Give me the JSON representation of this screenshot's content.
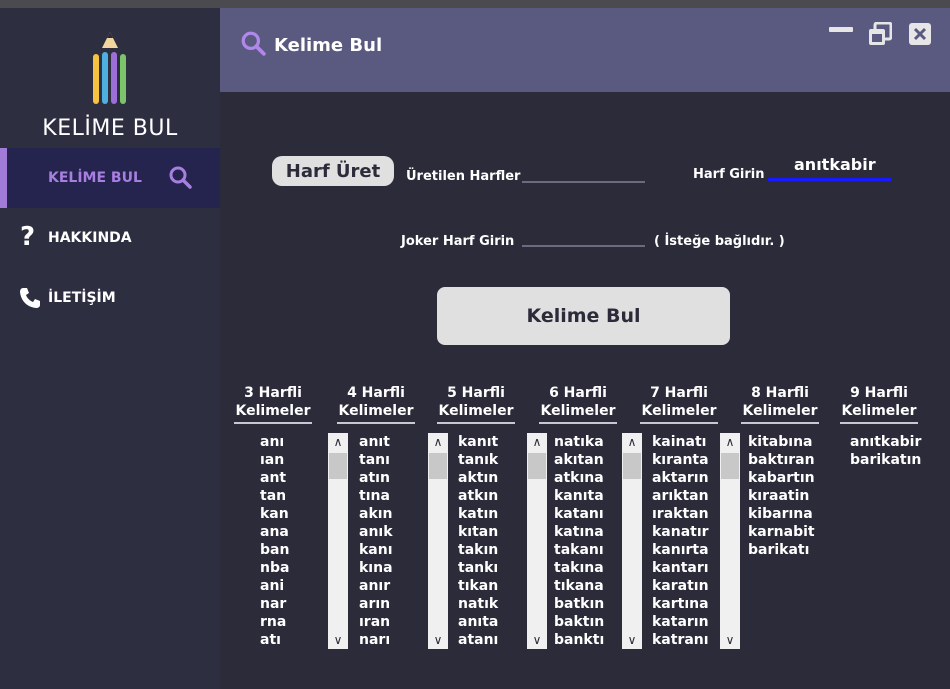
{
  "brand": {
    "name": "KELİME BUL"
  },
  "sidebar": {
    "items": [
      {
        "label": "KELİME BUL",
        "icon": "search-icon",
        "active": true
      },
      {
        "label": "HAKKINDA",
        "icon": "question-icon",
        "active": false
      },
      {
        "label": "İLETİŞİM",
        "icon": "phone-icon",
        "active": false
      }
    ]
  },
  "header": {
    "title": "Kelime Bul"
  },
  "form": {
    "generate_button": "Harf Üret",
    "generated_label": "Üretilen Harfler",
    "generated_value": "",
    "letters_label": "Harf Girin",
    "letters_value": "anıtkabir",
    "joker_label": "Joker Harf Girin",
    "joker_value": "",
    "joker_hint": "( İsteğe bağlıdır. )",
    "find_button": "Kelime Bul"
  },
  "columns": [
    {
      "line1": "3 Harfli",
      "line2": "Kelimeler",
      "words": [
        "anı",
        "ıan",
        "ant",
        "tan",
        "kan",
        "ana",
        "ban",
        "nba",
        "ani",
        "nar",
        "rna",
        "atı"
      ],
      "scroll": false
    },
    {
      "line1": "4 Harfli",
      "line2": "Kelimeler",
      "words": [
        "anıt",
        "tanı",
        "atın",
        "tına",
        "akın",
        "anık",
        "kanı",
        "kına",
        "anır",
        "arın",
        "ıran",
        "narı"
      ],
      "scroll": true
    },
    {
      "line1": "5 Harfli",
      "line2": "Kelimeler",
      "words": [
        "kanıt",
        "tanık",
        "aktın",
        "atkın",
        "katın",
        "kıtan",
        "takın",
        "tankı",
        "tıkan",
        "natık",
        "anıta",
        "atanı"
      ],
      "scroll": true
    },
    {
      "line1": "6 Harfli",
      "line2": "Kelimeler",
      "words": [
        "natıka",
        "akıtan",
        "atkına",
        "kanıta",
        "katanı",
        "katına",
        "takanı",
        "takına",
        "tıkana",
        "batkın",
        "baktın",
        "banktı"
      ],
      "scroll": true
    },
    {
      "line1": "7 Harfli",
      "line2": "Kelimeler",
      "words": [
        "kainatı",
        "kıranta",
        "aktarın",
        "arıktan",
        "ıraktan",
        "kanatır",
        "kanırta",
        "kantarı",
        "karatın",
        "kartına",
        "katarın",
        "katranı"
      ],
      "scroll": true
    },
    {
      "line1": "8 Harfli",
      "line2": "Kelimeler",
      "words": [
        "kitabına",
        "baktıran",
        "kabartın",
        "kıraatin",
        "kibarına",
        "karnabit",
        "barikatı"
      ],
      "scroll": true
    },
    {
      "line1": "9 Harfli",
      "line2": "Kelimeler",
      "words": [
        "anıtkabir",
        "barikatın"
      ],
      "scroll": false
    }
  ],
  "colors": {
    "sidebar_bg": "#2e2e41",
    "header_bg": "#5a5a80",
    "main_bg": "#2b2b3a",
    "accent": "#a07cd8",
    "active_input_line": "#1a1aff"
  }
}
